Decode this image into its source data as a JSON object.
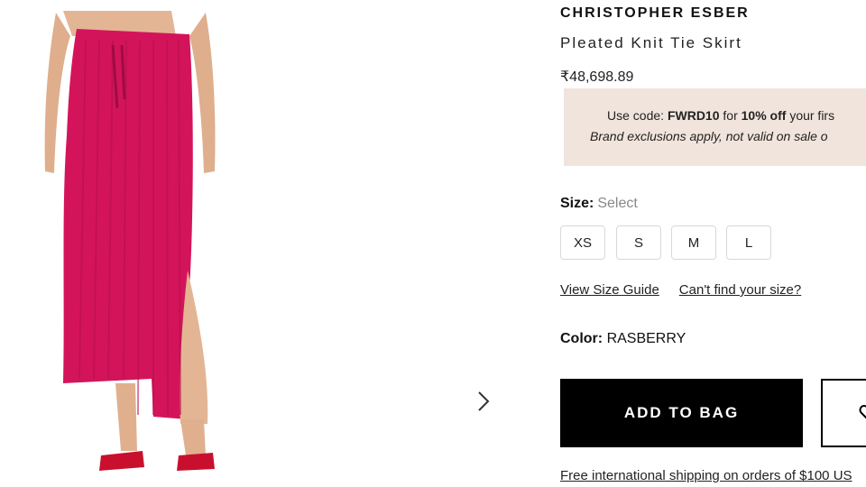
{
  "product": {
    "brand": "CHRISTOPHER ESBER",
    "name": "Pleated Knit Tie Skirt",
    "price": "₹48,698.89",
    "image_colors": {
      "skirt": "#d4145a",
      "skin": "#e3b594",
      "sandal": "#c8102e"
    }
  },
  "promo": {
    "use_code": "Use code:",
    "code": "FWRD10",
    "for": "for",
    "discount": "10% off",
    "rest": "your firs",
    "exclusions": "Brand exclusions apply, not valid on sale o"
  },
  "size": {
    "label": "Size:",
    "value": "Select",
    "options": [
      "XS",
      "S",
      "M",
      "L"
    ]
  },
  "links": {
    "size_guide": "View Size Guide",
    "cant_find": "Can't find your size?"
  },
  "color": {
    "label": "Color:",
    "value": "RASBERRY"
  },
  "actions": {
    "add_to_bag": "ADD TO BAG"
  },
  "shipping": "Free international shipping on orders of $100 US"
}
